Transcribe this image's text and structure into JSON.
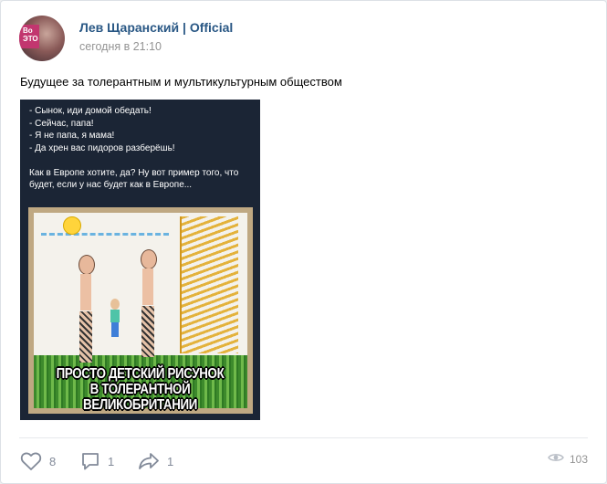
{
  "post": {
    "author": "Лев Щаранский | Official",
    "time": "сегодня в 21:10",
    "text": "Будущее за толерантным и мультикультурным обществом",
    "avatar_text": "Во\nЭТО",
    "image": {
      "dialog_text": "- Сынок, иди домой обедать!\n- Сейчас, папа!\n- Я не папа, я мама!\n- Да хрен вас пидоров разберёшь!\n\nКак в Европе хотите, да? Ну вот пример того, что будет, если у нас будет как в Европе...",
      "caption_line1": "ПРОСТО ДЕТСКИЙ РИСУНОК",
      "caption_line2": "В ТОЛЕРАНТНОЙ ВЕЛИКОБРИТАНИИ"
    }
  },
  "actions": {
    "likes": "8",
    "comments": "1",
    "shares": "1",
    "views": "103",
    "like_icon": "heart-icon",
    "comment_icon": "comment-icon",
    "share_icon": "share-icon",
    "views_icon": "eye-icon"
  },
  "colors": {
    "author_link": "#2a5885",
    "meta_gray": "#939393",
    "icon_gray": "#828a99",
    "card_border": "#dce1e6",
    "page_bg": "#edeef0"
  }
}
